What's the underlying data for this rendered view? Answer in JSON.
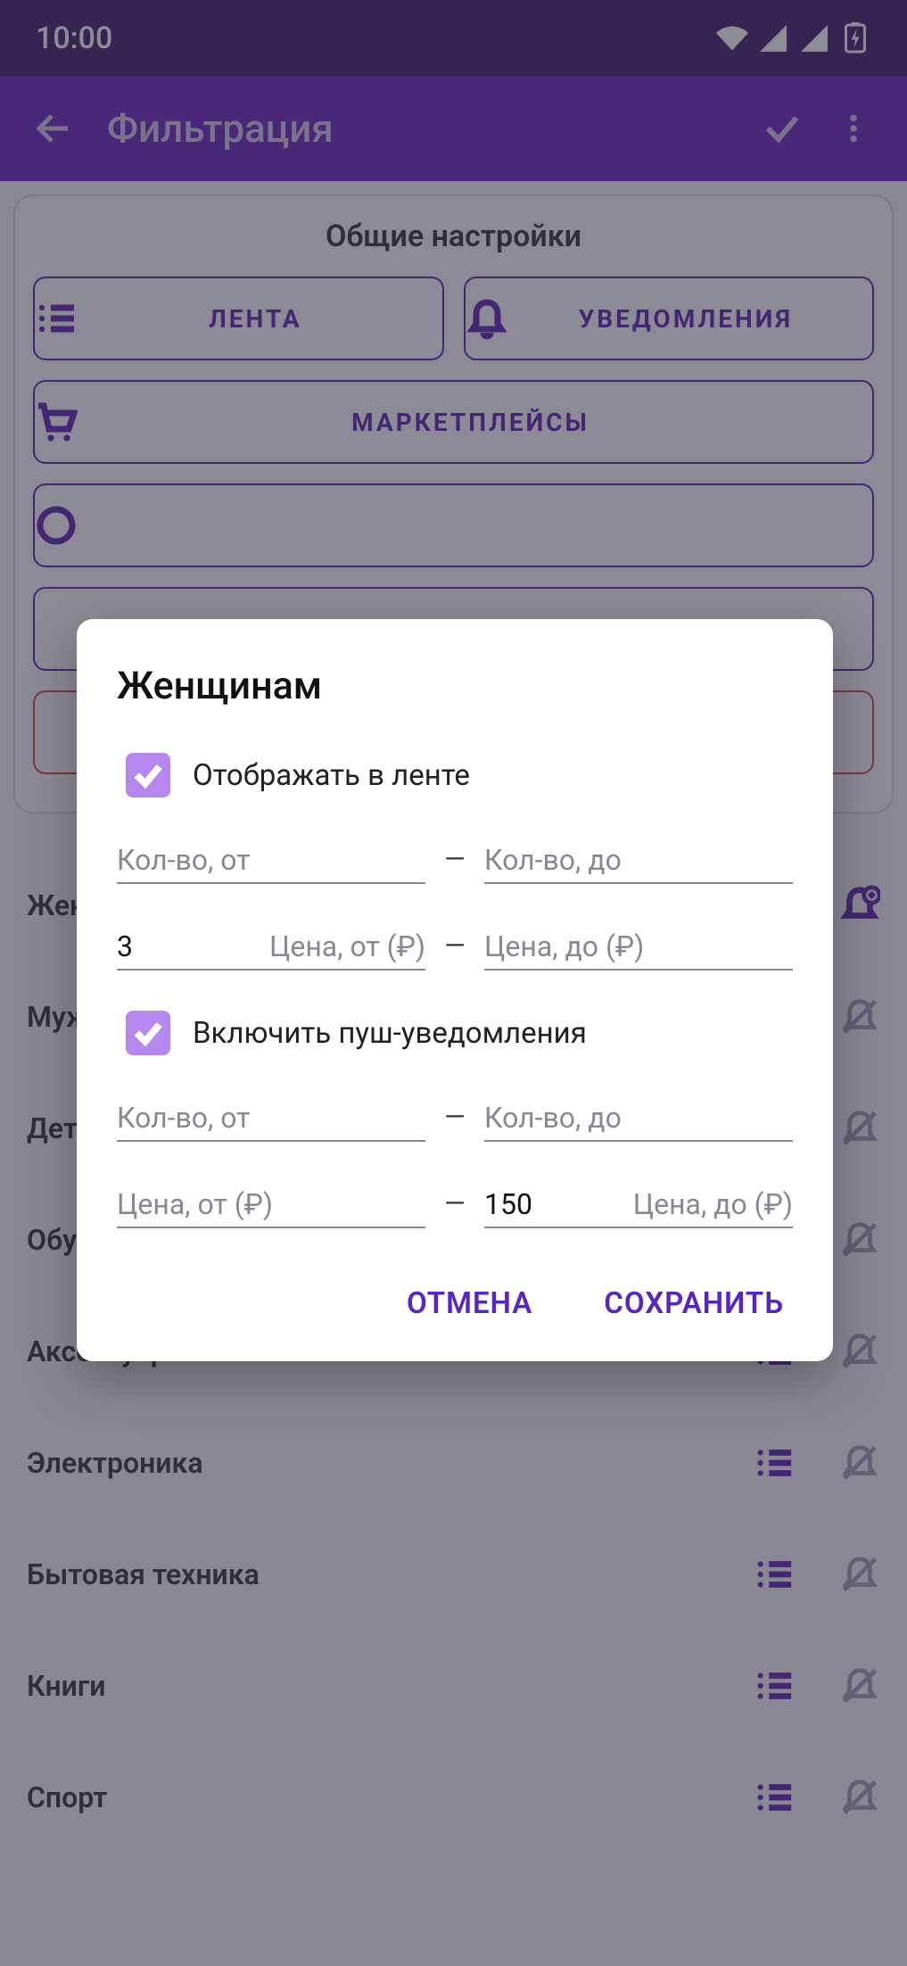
{
  "status": {
    "time": "10:00"
  },
  "appbar": {
    "title": "Фильтрация"
  },
  "card": {
    "title": "Общие настройки",
    "btn_feed": "ЛЕНТА",
    "btn_notif": "УВЕДОМЛЕНИЯ",
    "btn_market": "МАРКЕТПЛЕЙСЫ"
  },
  "categories": [
    {
      "label": "Женщинам"
    },
    {
      "label": "Мужчинам"
    },
    {
      "label": "Детям"
    },
    {
      "label": "Обувь"
    },
    {
      "label": "Аксессуары"
    },
    {
      "label": "Электроника"
    },
    {
      "label": "Бытовая техника"
    },
    {
      "label": "Книги"
    },
    {
      "label": "Спорт"
    }
  ],
  "dialog": {
    "title": "Женщинам",
    "show_in_feed_label": "Отображать в ленте",
    "enable_push_label": "Включить пуш-уведомления",
    "qty_from_ph": "Кол-во, от",
    "qty_to_ph": "Кол-во, до",
    "price_from_ph": "Цена, от (₽)",
    "price_to_ph": "Цена, до (₽)",
    "feed_price_from": "3",
    "push_price_to": "150",
    "cancel": "ОТМЕНА",
    "save": "СОХРАНИТЬ"
  }
}
